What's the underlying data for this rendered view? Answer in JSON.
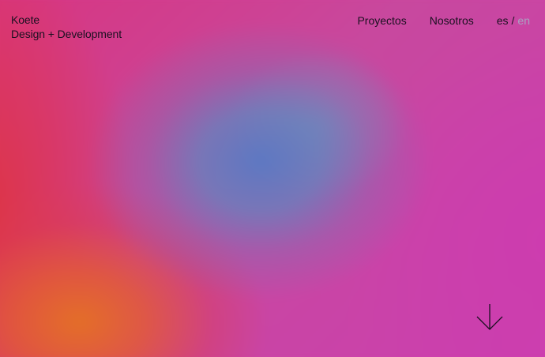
{
  "brand": {
    "name": "Koete",
    "tagline": "Design + Development"
  },
  "nav": {
    "items": [
      {
        "label": "Proyectos"
      },
      {
        "label": "Nosotros"
      }
    ],
    "language": {
      "active": "es",
      "separator": "/",
      "inactive": "en"
    }
  },
  "scroll_indicator": {
    "icon": "arrow-down-icon"
  },
  "colors": {
    "text": "#1a1020",
    "inactive_lang": "#a9a2c2",
    "gradient_pink": "#cf3f9f",
    "gradient_blue": "#587ac4",
    "gradient_orange": "#e46e28",
    "gradient_red": "#de3442"
  }
}
